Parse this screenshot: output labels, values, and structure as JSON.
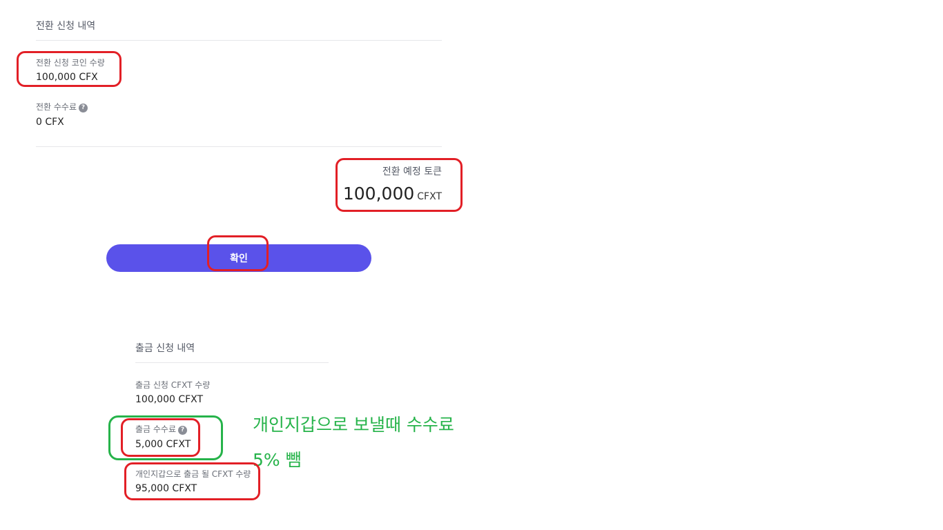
{
  "conversion": {
    "title": "전환 신청 내역",
    "coin_amount": {
      "label": "전환 신청 코인 수량",
      "value": "100,000 CFX"
    },
    "fee": {
      "label": "전환 수수료",
      "help_icon": "question-circle-icon",
      "value": "0 CFX"
    },
    "expected_token": {
      "label": "전환 예정 토큰",
      "amount": "100,000",
      "unit": "CFXT"
    }
  },
  "confirm_button": {
    "label": "확인",
    "color": "#5a52ea"
  },
  "withdrawal": {
    "title": "출금 신청 내역",
    "request_amount": {
      "label": "출금 신청 CFXT 수량",
      "value": "100,000 CFXT"
    },
    "fee": {
      "label": "출금 수수료",
      "help_icon": "question-circle-icon",
      "value": "5,000 CFXT"
    },
    "net_amount": {
      "label": "개인지갑으로 출금 될 CFXT 수량",
      "value": "95,000 CFXT"
    }
  },
  "annotations": {
    "note_line1": "개인지갑으로 보낼때 수수료",
    "note_line2": "5% 뺌",
    "highlight_red": "#e21f26",
    "highlight_green": "#26b34a"
  }
}
